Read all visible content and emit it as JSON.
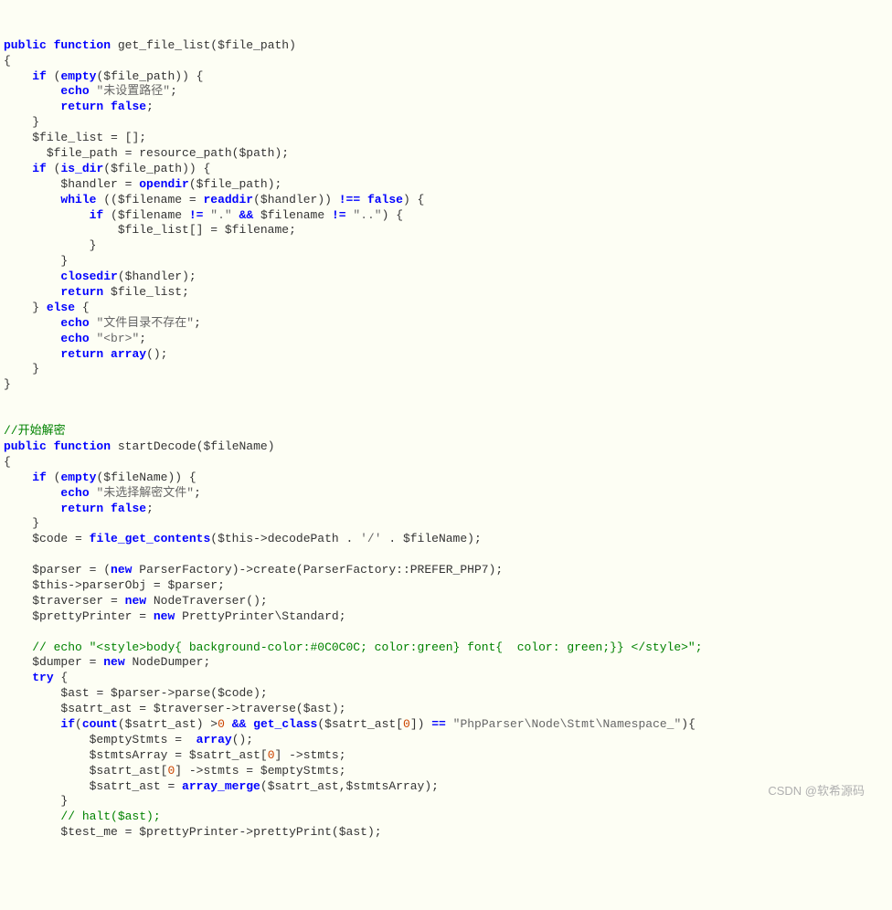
{
  "watermark": "CSDN @软希源码",
  "c": {
    "kw_public": "public",
    "kw_function": "function",
    "kw_if": "if",
    "kw_else": "else",
    "kw_echo": "echo",
    "kw_return": "return",
    "kw_false": "false",
    "kw_while": "while",
    "kw_new": "new",
    "kw_try": "try",
    "fn_get_file_list": "get_file_list",
    "fn_startDecode": "startDecode",
    "fn_empty": "empty",
    "fn_resource_path": "resource_path",
    "fn_is_dir": "is_dir",
    "fn_opendir": "opendir",
    "fn_readdir": "readdir",
    "fn_closedir": "closedir",
    "fn_array": "array",
    "fn_file_get_contents": "file_get_contents",
    "fn_count": "count",
    "fn_get_class": "get_class",
    "fn_array_merge": "array_merge",
    "v_file_path": "$file_path",
    "v_file_list": "$file_list",
    "v_path": "$path",
    "v_handler": "$handler",
    "v_filename": "$filename",
    "v_fileName": "$fileName",
    "v_code": "$code",
    "v_this": "$this",
    "v_parser": "$parser",
    "v_traverser": "$traverser",
    "v_prettyPrinter": "$prettyPrinter",
    "v_dumper": "$dumper",
    "v_ast": "$ast",
    "v_satrt_ast": "$satrt_ast",
    "v_emptyStmts": "$emptyStmts",
    "v_stmtsArray": "$stmtsArray",
    "v_test_me": "$test_me",
    "s_nopath": "\"未设置路径\"",
    "s_dot": "\".\"",
    "s_dotdot": "\"..\"",
    "s_nodir": "\"文件目录不存在\"",
    "s_br": "\"<br>\"",
    "s_nofile": "\"未选择解密文件\"",
    "s_slash": "'/'",
    "s_ns": "\"PhpParser\\Node\\Stmt\\Namespace_\"",
    "cm_start": "//开始解密",
    "cm_slash": "//",
    "cm_style": "// echo \"<style>body{ background-color:#0C0C0C; color:green} font{  color: green;}} </style>\";",
    "cm_halt": "// halt($ast);",
    "t_ParserFactory": "ParserFactory",
    "t_create": "create",
    "t_PREFER_PHP7": "PREFER_PHP7",
    "t_parserObj": "parserObj",
    "t_NodeTraverser": "NodeTraverser",
    "t_PrettyPrinterStd": "PrettyPrinter\\Standard",
    "t_NodeDumper": "NodeDumper",
    "t_parse": "parse",
    "t_traverse": "traverse",
    "t_stmts": "stmts",
    "t_prettyPrint": "prettyPrint",
    "t_decodePath": "decodePath",
    "n_0": "0",
    "op_and": "&&",
    "op_neq": "!=",
    "op_neqs": "!==",
    "op_eq": "=="
  }
}
